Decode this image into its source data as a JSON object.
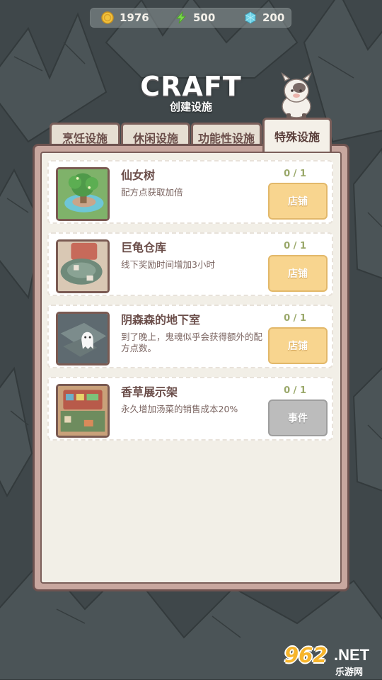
{
  "resources": {
    "coins": "1976",
    "energy": "500",
    "gems": "200"
  },
  "title": "CRAFT",
  "subtitle": "创建设施",
  "tabs": [
    {
      "label": "烹饪设施",
      "active": false
    },
    {
      "label": "休闲设施",
      "active": false
    },
    {
      "label": "功能性设施",
      "active": false
    },
    {
      "label": "特殊设施",
      "active": true
    }
  ],
  "facilities": [
    {
      "name": "仙女树",
      "desc": "配方点获取加倍",
      "count": "0 / 1",
      "button": "店铺",
      "button_type": "shop"
    },
    {
      "name": "巨龟仓库",
      "desc": "线下奖励时间增加3小时",
      "count": "0 / 1",
      "button": "店铺",
      "button_type": "shop"
    },
    {
      "name": "阴森森的地下室",
      "desc": "到了晚上，鬼魂似乎会获得额外的配方点数。",
      "count": "0 / 1",
      "button": "店铺",
      "button_type": "shop"
    },
    {
      "name": "香草展示架",
      "desc": "永久增加汤菜的销售成本20%",
      "count": "0 / 1",
      "button": "事件",
      "button_type": "event"
    }
  ],
  "watermark": {
    "number": "962",
    "domain": ".NET",
    "site": "乐游网"
  },
  "colors": {
    "background": "#3e4649",
    "panel_border": "#6e5350",
    "shop_button": "#f8d58f",
    "event_button": "#bcbcbc",
    "count_text": "#9aa86a"
  }
}
